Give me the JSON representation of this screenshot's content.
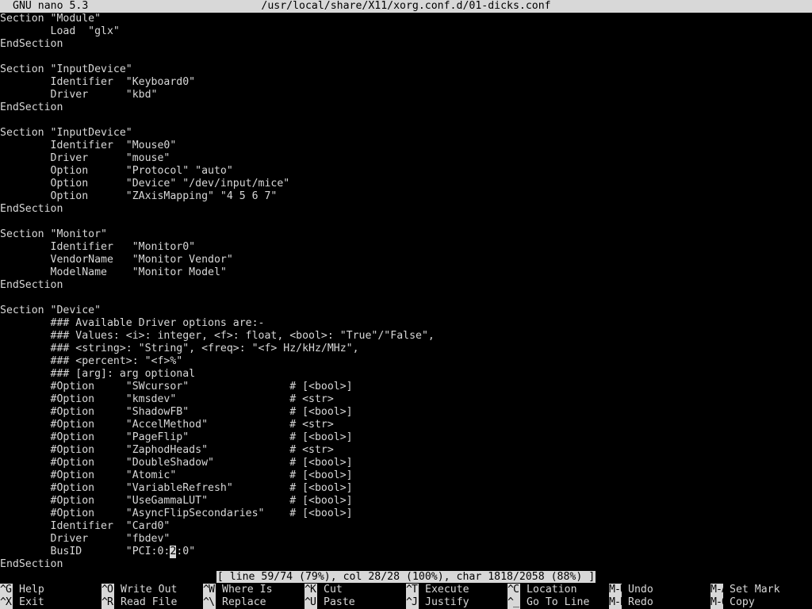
{
  "titlebar": {
    "version": "GNU nano 5.3",
    "filename": "/usr/local/share/X11/xorg.conf.d/01-dicks.conf"
  },
  "editor": {
    "lines": [
      "Section \"Module\"",
      "        Load  \"glx\"",
      "EndSection",
      "",
      "Section \"InputDevice\"",
      "        Identifier  \"Keyboard0\"",
      "        Driver      \"kbd\"",
      "EndSection",
      "",
      "Section \"InputDevice\"",
      "        Identifier  \"Mouse0\"",
      "        Driver      \"mouse\"",
      "        Option      \"Protocol\" \"auto\"",
      "        Option      \"Device\" \"/dev/input/mice\"",
      "        Option      \"ZAxisMapping\" \"4 5 6 7\"",
      "EndSection",
      "",
      "Section \"Monitor\"",
      "        Identifier   \"Monitor0\"",
      "        VendorName   \"Monitor Vendor\"",
      "        ModelName    \"Monitor Model\"",
      "EndSection",
      "",
      "Section \"Device\"",
      "        ### Available Driver options are:-",
      "        ### Values: <i>: integer, <f>: float, <bool>: \"True\"/\"False\",",
      "        ### <string>: \"String\", <freq>: \"<f> Hz/kHz/MHz\",",
      "        ### <percent>: \"<f>%\"",
      "        ### [arg]: arg optional",
      "        #Option     \"SWcursor\"                # [<bool>]",
      "        #Option     \"kmsdev\"                  # <str>",
      "        #Option     \"ShadowFB\"                # [<bool>]",
      "        #Option     \"AccelMethod\"             # <str>",
      "        #Option     \"PageFlip\"                # [<bool>]",
      "        #Option     \"ZaphodHeads\"             # <str>",
      "        #Option     \"DoubleShadow\"            # [<bool>]",
      "        #Option     \"Atomic\"                  # [<bool>]",
      "        #Option     \"VariableRefresh\"         # [<bool>]",
      "        #Option     \"UseGammaLUT\"             # [<bool>]",
      "        #Option     \"AsyncFlipSecondaries\"    # [<bool>]",
      "        Identifier  \"Card0\"",
      "        Driver      \"fbdev\"",
      "        BusID       \"PCI:0:",
      "EndSection"
    ],
    "cursor_line_tail": {
      "cursor_char": "2",
      "after_cursor": ":0\""
    }
  },
  "status": {
    "text": "[ line 59/74 (79%), col 28/28 (100%), char 1818/2058 (88%) ]"
  },
  "shortcuts": [
    {
      "key": "^G",
      "label": "Help"
    },
    {
      "key": "^X",
      "label": "Exit"
    },
    {
      "key": "^O",
      "label": "Write Out"
    },
    {
      "key": "^R",
      "label": "Read File"
    },
    {
      "key": "^W",
      "label": "Where Is"
    },
    {
      "key": "^\\",
      "label": "Replace"
    },
    {
      "key": "^K",
      "label": "Cut"
    },
    {
      "key": "^U",
      "label": "Paste"
    },
    {
      "key": "^T",
      "label": "Execute"
    },
    {
      "key": "^J",
      "label": "Justify"
    },
    {
      "key": "^C",
      "label": "Location"
    },
    {
      "key": "^_",
      "label": "Go To Line"
    },
    {
      "key": "M-U",
      "label": "Undo"
    },
    {
      "key": "M-E",
      "label": "Redo"
    },
    {
      "key": "M-A",
      "label": "Set Mark"
    },
    {
      "key": "M-6",
      "label": "Copy"
    }
  ],
  "colors": {
    "background": "#000000",
    "foreground": "#d8d8d8",
    "inverse_background": "#d8d8d8",
    "inverse_foreground": "#000000"
  }
}
